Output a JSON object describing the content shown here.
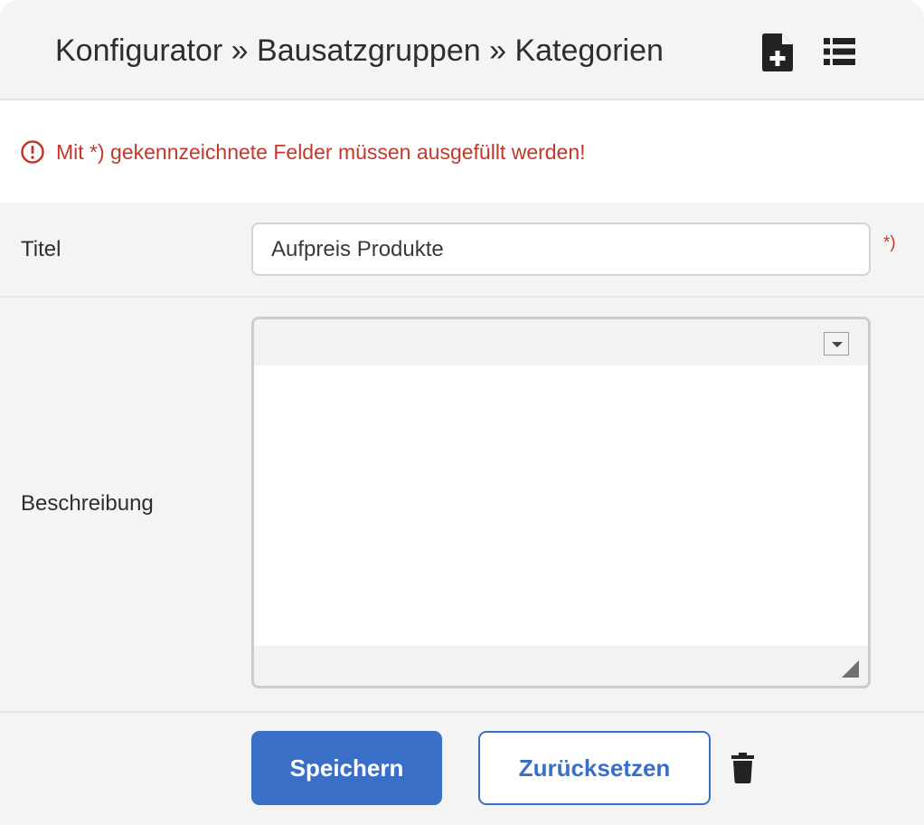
{
  "header": {
    "breadcrumb": "Konfigurator » Bausatzgruppen » Kategorien",
    "icons": {
      "new": "file-plus-icon",
      "list": "list-icon"
    }
  },
  "alert": {
    "icon": "exclamation-circle-icon",
    "message": "Mit *) gekennzeichnete Felder müssen ausgefüllt werden!",
    "color": "#c0392b"
  },
  "form": {
    "title_label": "Titel",
    "title_value": "Aufpreis Produkte",
    "required_marker": "*)",
    "description_label": "Beschreibung",
    "description_value": ""
  },
  "actions": {
    "save_label": "Speichern",
    "reset_label": "Zurücksetzen",
    "delete_icon": "trash-icon"
  },
  "colors": {
    "accent": "#3a6fc7",
    "error": "#c0392b",
    "panel_bg": "#f4f4f4"
  }
}
